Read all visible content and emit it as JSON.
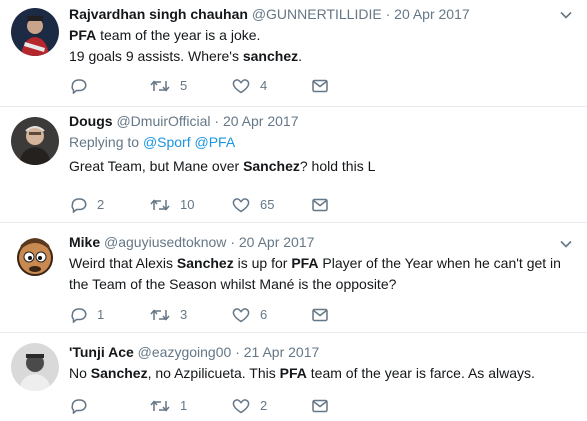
{
  "tweets": [
    {
      "name": "Rajvardhan singh chauhan",
      "handle": "@GUNNERTILLIDIE",
      "separator": "·",
      "date": "20 Apr 2017",
      "text_segments": [
        {
          "text": "PFA",
          "bold": true
        },
        {
          "text": " team of the year is a joke.",
          "bold": false
        },
        {
          "text": "\n19 goals 9 assists. Where's ",
          "bold": false
        },
        {
          "text": "sanchez",
          "bold": true
        },
        {
          "text": ".",
          "bold": false
        }
      ],
      "replies": "",
      "retweets": "5",
      "likes": "4"
    },
    {
      "name": "Dougs",
      "handle": "@DmuirOfficial",
      "separator": "·",
      "date": "20 Apr 2017",
      "replying_prefix": "Replying to",
      "replying_to": "@Sporf @PFA",
      "text_segments": [
        {
          "text": "Great Team, but Mane over ",
          "bold": false
        },
        {
          "text": "Sanchez",
          "bold": true
        },
        {
          "text": "? hold this L",
          "bold": false
        }
      ],
      "replies": "2",
      "retweets": "10",
      "likes": "65"
    },
    {
      "name": "Mike",
      "handle": "@aguyiusedtoknow",
      "separator": "·",
      "date": "20 Apr 2017",
      "text_segments": [
        {
          "text": "Weird that Alexis ",
          "bold": false
        },
        {
          "text": "Sanchez",
          "bold": true
        },
        {
          "text": " is up for ",
          "bold": false
        },
        {
          "text": "PFA",
          "bold": true
        },
        {
          "text": " Player of the Year when he can't get in the Team of the Season whilst Mané is the opposite?",
          "bold": false
        }
      ],
      "replies": "1",
      "retweets": "3",
      "likes": "6"
    },
    {
      "name": "'Tunji Ace",
      "handle": "@eazygoing00",
      "separator": "·",
      "date": "21 Apr 2017",
      "text_segments": [
        {
          "text": "No ",
          "bold": false
        },
        {
          "text": "Sanchez",
          "bold": true
        },
        {
          "text": ", no Azpilicueta. This ",
          "bold": false
        },
        {
          "text": "PFA",
          "bold": true
        },
        {
          "text": " team of the year is farce. As always.",
          "bold": false
        }
      ],
      "replies": "",
      "retweets": "1",
      "likes": "2"
    }
  ],
  "icons": {
    "reply": "reply-icon",
    "retweet": "retweet-icon",
    "like": "heart-icon",
    "message": "envelope-icon",
    "more": "chevron-down-icon"
  },
  "colors": {
    "name": "#14171a",
    "meta": "#657786",
    "link": "#1b95e0",
    "divider": "#e6ecf0"
  }
}
